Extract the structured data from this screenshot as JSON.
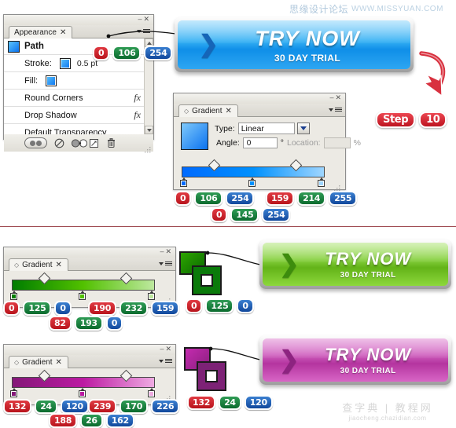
{
  "watermarks": {
    "top_cn": "思缘设计论坛",
    "top_en": "WWW.MISSYUAN.COM",
    "bottom_cn": "查字典 | 教程网",
    "bottom_en": "jiaocheng.chazidian.com"
  },
  "appearance_panel": {
    "tab_label": "Appearance",
    "tab_close": "✕",
    "win_min": "–",
    "win_close": "✕",
    "rows": [
      {
        "label": "Path",
        "type": "head"
      },
      {
        "label": "Stroke:",
        "value": "0.5 pt",
        "type": "stroke"
      },
      {
        "label": "Fill:",
        "type": "fill"
      },
      {
        "label": "Round Corners",
        "type": "fx",
        "fx": "fx"
      },
      {
        "label": "Drop Shadow",
        "type": "fx",
        "fx": "fx"
      },
      {
        "label": "Default Transparency",
        "type": "plain"
      }
    ],
    "footer_icons": [
      "toggle-pill",
      "no-entry-icon",
      "duplicate-circles-icon",
      "new-item-icon",
      "trash-icon"
    ],
    "stroke_rgb": {
      "r": "0",
      "g": "106",
      "b": "254"
    }
  },
  "gradient_blue": {
    "tab_label": "Gradient",
    "tab_close": "✕",
    "win_min": "–",
    "win_close": "✕",
    "type_label": "Type:",
    "type_value": "Linear",
    "angle_label": "Angle:",
    "angle_value": "0",
    "degree_symbol": "°",
    "location_label": "Location:",
    "location_value": "",
    "percent_symbol": "%",
    "stops": [
      {
        "pos": 0,
        "color": "#006afe"
      },
      {
        "pos": 50,
        "color": "#0091fe"
      },
      {
        "pos": 100,
        "color": "#9fd6ff"
      }
    ],
    "midpoints": [
      22,
      78
    ],
    "rgb_left": {
      "r": "0",
      "g": "106",
      "b": "254"
    },
    "rgb_right": {
      "r": "159",
      "g": "214",
      "b": "255"
    },
    "rgb_mid": {
      "r": "0",
      "g": "145",
      "b": "254"
    }
  },
  "gradient_green": {
    "tab_label": "Gradient",
    "tab_close": "✕",
    "win_min": "–",
    "win_close": "✕",
    "stops": [
      {
        "pos": 0,
        "color": "#007d00"
      },
      {
        "pos": 50,
        "color": "#52c100"
      },
      {
        "pos": 100,
        "color": "#bee89f"
      }
    ],
    "midpoints": [
      22,
      78
    ],
    "rgb_left": {
      "r": "0",
      "g": "125",
      "b": "0"
    },
    "rgb_right": {
      "r": "190",
      "g": "232",
      "b": "159"
    },
    "rgb_mid": {
      "r": "82",
      "g": "193",
      "b": "0"
    },
    "swatch_rgb": {
      "r": "0",
      "g": "125",
      "b": "0"
    }
  },
  "gradient_purple": {
    "tab_label": "Gradient",
    "tab_close": "✕",
    "win_min": "–",
    "win_close": "✕",
    "stops": [
      {
        "pos": 0,
        "color": "#841878"
      },
      {
        "pos": 50,
        "color": "#bc1aa2"
      },
      {
        "pos": 100,
        "color": "#efaae2"
      }
    ],
    "midpoints": [
      22,
      78
    ],
    "rgb_left": {
      "r": "132",
      "g": "24",
      "b": "120"
    },
    "rgb_right": {
      "r": "239",
      "g": "170",
      "b": "226"
    },
    "rgb_mid": {
      "r": "188",
      "g": "26",
      "b": "162"
    },
    "swatch_rgb": {
      "r": "132",
      "g": "24",
      "b": "120"
    }
  },
  "buttons": {
    "blue": {
      "main": "TRY NOW",
      "sub": "30 DAY TRIAL",
      "chevron": "❯",
      "accent": "#1ea2f0"
    },
    "green": {
      "main": "TRY NOW",
      "sub": "30 DAY TRIAL",
      "chevron": "❯",
      "accent": "#6ec62a"
    },
    "purple": {
      "main": "TRY NOW",
      "sub": "30 DAY TRIAL",
      "chevron": "❯",
      "accent": "#c44cb5"
    }
  },
  "step_callout": {
    "word": "Step",
    "number": "10"
  }
}
